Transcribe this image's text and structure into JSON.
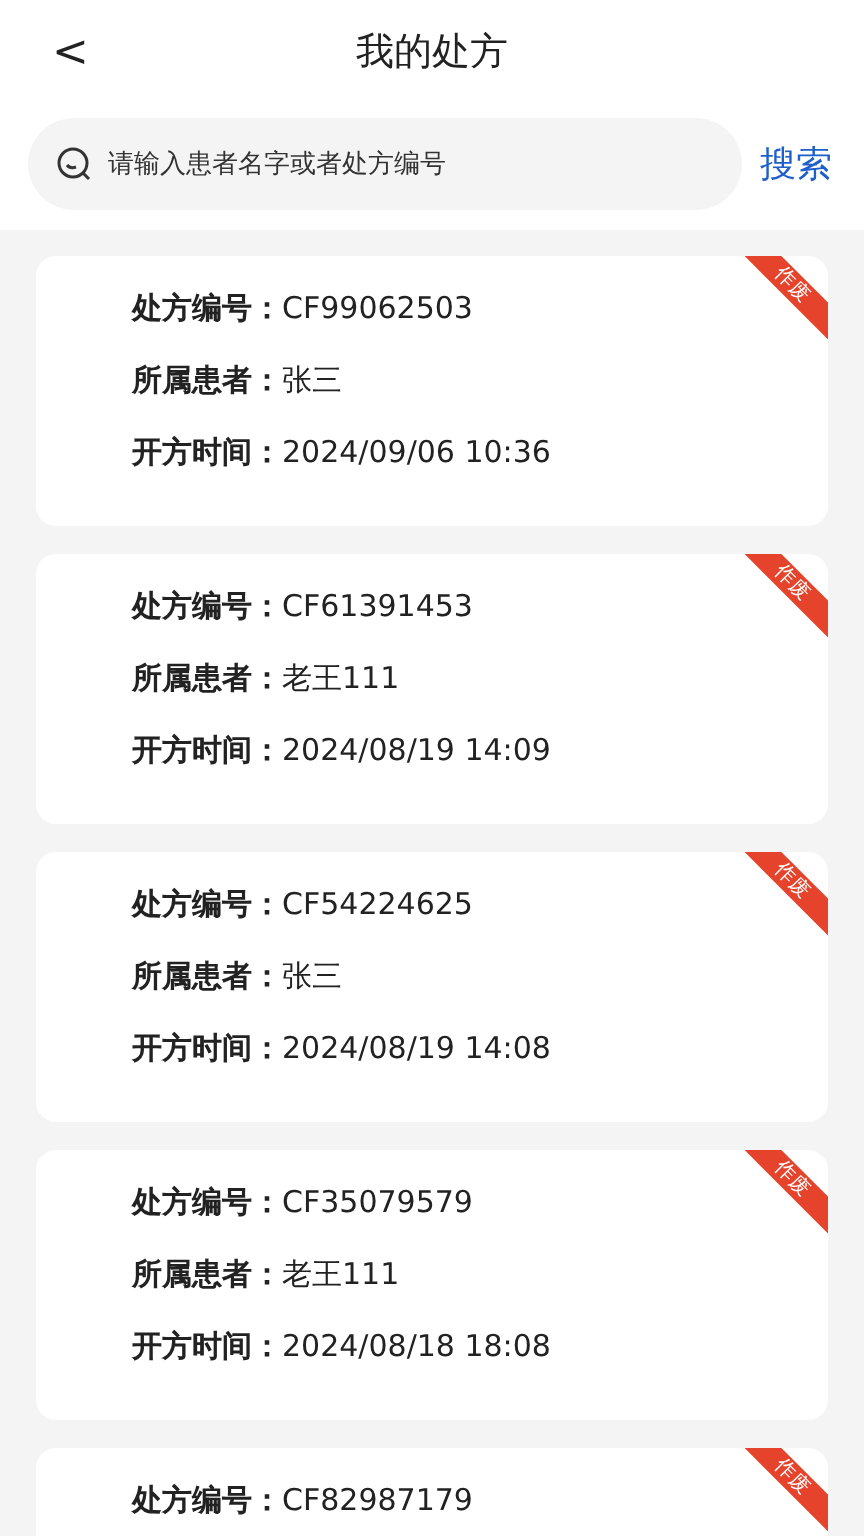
{
  "header": {
    "back": "<",
    "title": "我的处方"
  },
  "search": {
    "placeholder": "请输入患者名字或者处方编号",
    "button": "搜索"
  },
  "prescriptions": [
    {
      "voided": true,
      "ribbon": "作废",
      "fields": [
        {
          "label": "处方编号：",
          "value": "CF99062503"
        },
        {
          "label": "所属患者：",
          "value": "张三"
        },
        {
          "label": "开方时间：",
          "value": "2024/09/06 10:36"
        }
      ]
    },
    {
      "voided": true,
      "ribbon": "作废",
      "fields": [
        {
          "label": "处方编号：",
          "value": "CF61391453"
        },
        {
          "label": "所属患者：",
          "value": "老王111"
        },
        {
          "label": "开方时间：",
          "value": "2024/08/19 14:09"
        }
      ]
    },
    {
      "voided": true,
      "ribbon": "作废",
      "fields": [
        {
          "label": "处方编号：",
          "value": "CF54224625"
        },
        {
          "label": "所属患者：",
          "value": "张三"
        },
        {
          "label": "开方时间：",
          "value": "2024/08/19 14:08"
        }
      ]
    },
    {
      "voided": true,
      "ribbon": "作废",
      "fields": [
        {
          "label": "处方编号：",
          "value": "CF35079579"
        },
        {
          "label": "所属患者：",
          "value": "老王111"
        },
        {
          "label": "开方时间：",
          "value": "2024/08/18 18:08"
        }
      ]
    },
    {
      "voided": true,
      "ribbon": "作废",
      "fields": [
        {
          "label": "处方编号：",
          "value": "CF82987179"
        }
      ]
    }
  ]
}
